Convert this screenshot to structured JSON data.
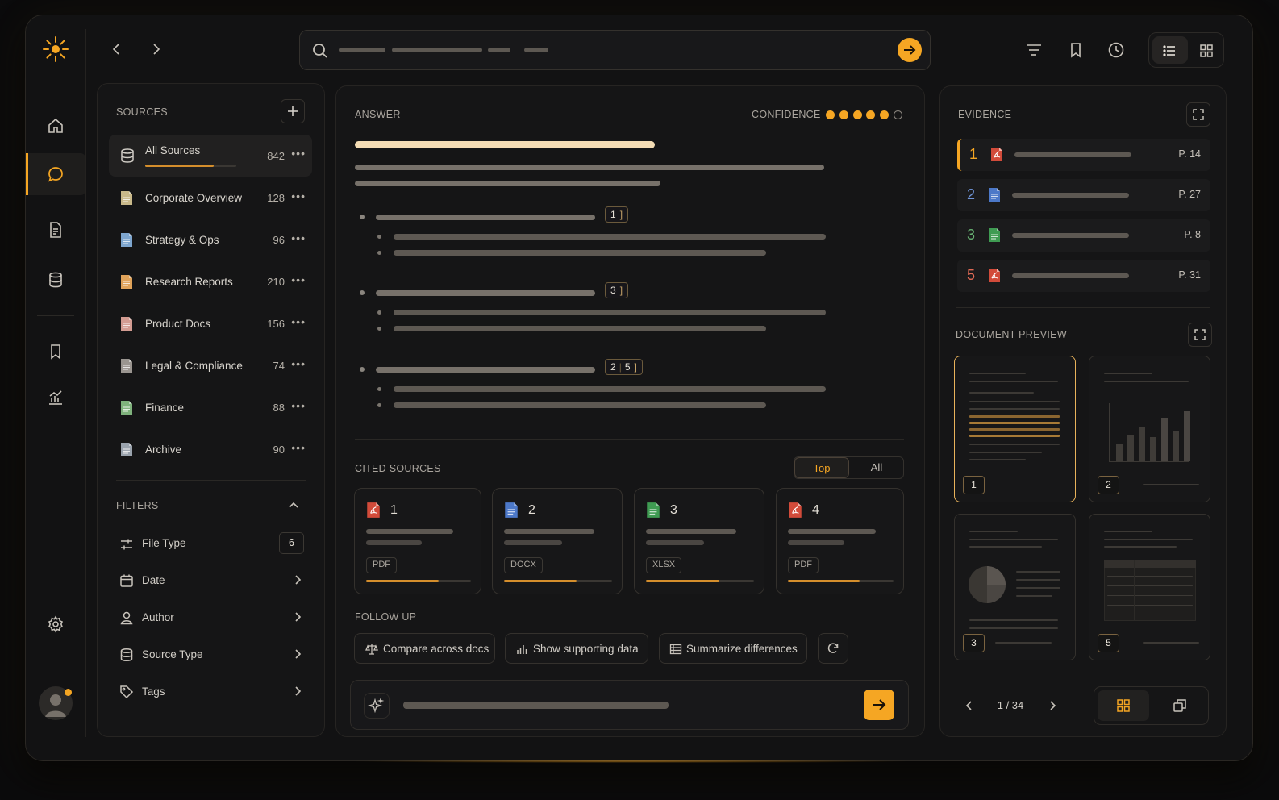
{
  "sources": {
    "title": "SOURCES",
    "items": [
      {
        "name": "All Sources",
        "count": "842",
        "icon": "database-icon"
      },
      {
        "name": "Corporate Overview",
        "count": "128",
        "color": "#c9b98a"
      },
      {
        "name": "Strategy & Ops",
        "count": "96",
        "color": "#7ea6cf"
      },
      {
        "name": "Research Reports",
        "count": "210",
        "color": "#e0a35a"
      },
      {
        "name": "Product Docs",
        "count": "156",
        "color": "#d39c92"
      },
      {
        "name": "Legal & Compliance",
        "count": "74",
        "color": "#9a9590"
      },
      {
        "name": "Finance",
        "count": "88",
        "color": "#7fb27c"
      },
      {
        "name": "Archive",
        "count": "90",
        "color": "#9aa3ad"
      }
    ],
    "all_progress": 0.75
  },
  "filters": {
    "title": "FILTERS",
    "items": [
      {
        "label": "File Type",
        "badge": "6"
      },
      {
        "label": "Date"
      },
      {
        "label": "Author"
      },
      {
        "label": "Source Type"
      },
      {
        "label": "Tags"
      }
    ]
  },
  "answer": {
    "title": "ANSWER",
    "confidence_label": "CONFIDENCE",
    "confidence": 5,
    "confidence_max": 6,
    "citations": [
      [
        "1"
      ],
      [
        "3"
      ],
      [
        "2",
        "5"
      ]
    ]
  },
  "cited": {
    "title": "CITED SOURCES",
    "tabs": [
      "Top",
      "All"
    ],
    "cards": [
      {
        "num": "1",
        "type": "PDF",
        "progress": 0.69
      },
      {
        "num": "2",
        "type": "DOCX",
        "progress": 0.67
      },
      {
        "num": "3",
        "type": "XLSX",
        "progress": 0.68
      },
      {
        "num": "4",
        "type": "PDF",
        "progress": 0.68
      }
    ]
  },
  "follow_up": {
    "title": "FOLLOW UP",
    "chips": [
      "Compare across docs",
      "Show supporting data",
      "Summarize differences"
    ]
  },
  "evidence": {
    "title": "EVIDENCE",
    "rows": [
      {
        "num": "1",
        "page": "P. 14",
        "kind": "pdf"
      },
      {
        "num": "2",
        "page": "P. 27",
        "kind": "docx"
      },
      {
        "num": "3",
        "page": "P. 8",
        "kind": "xlsx"
      },
      {
        "num": "5",
        "page": "P. 31",
        "kind": "pdf"
      }
    ]
  },
  "preview": {
    "title": "DOCUMENT PREVIEW",
    "thumbs": [
      "1",
      "2",
      "3",
      "5"
    ],
    "pager": "1 / 34"
  },
  "colors": {
    "accent": "#f5a623",
    "pdf": "#d24b3a",
    "docx": "#4c78c8",
    "xlsx": "#3f9b52"
  }
}
